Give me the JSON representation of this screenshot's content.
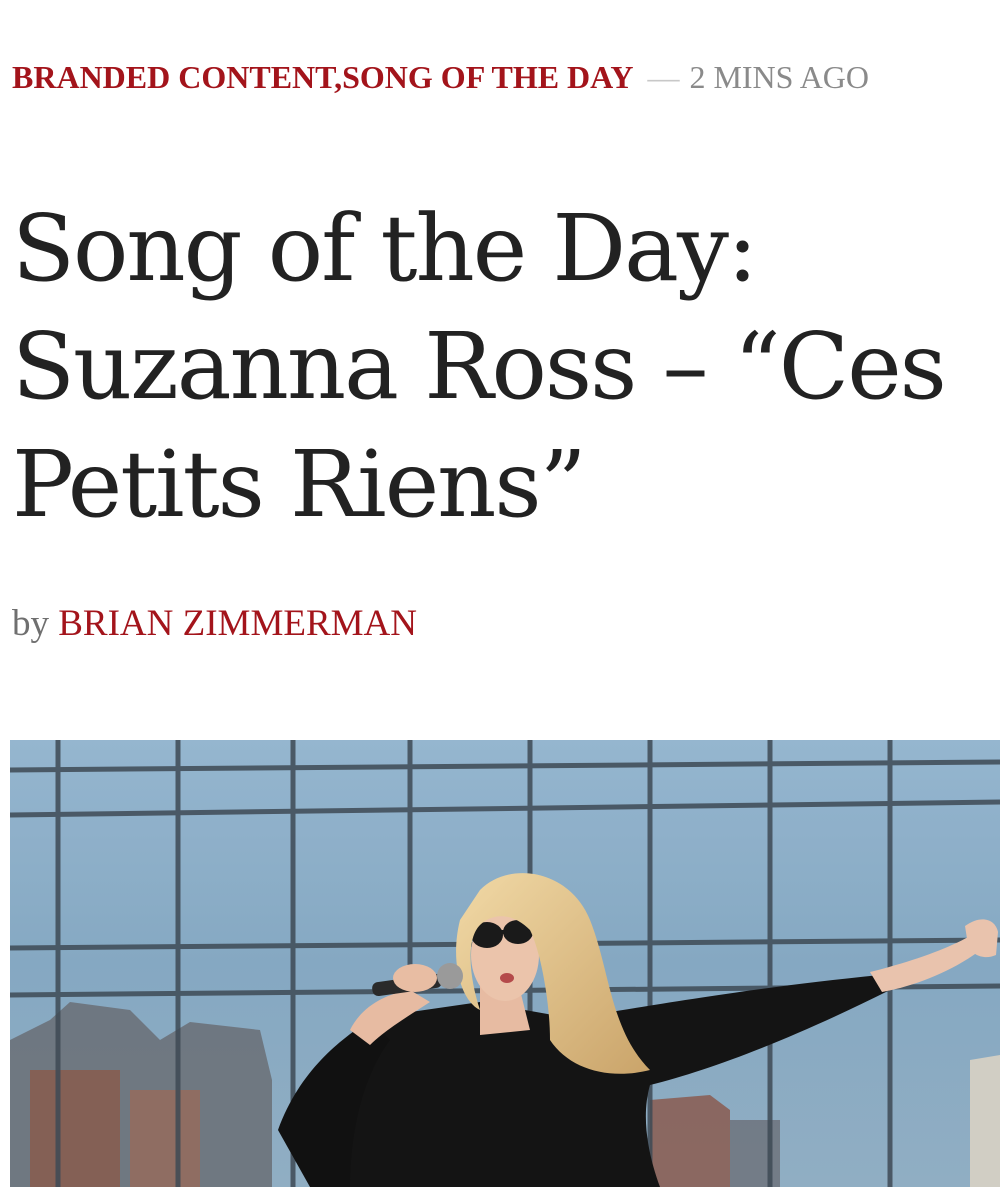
{
  "article": {
    "categories": [
      "BRANDED CONTENT",
      "SONG OF THE DAY"
    ],
    "separator": ",",
    "dash": "—",
    "time_ago": "2 MINS AGO",
    "title_lines": [
      "Song of the Day:",
      "Suzanna Ross – “Ces",
      "Petits Riens”"
    ],
    "by_label": "by",
    "author": "BRIAN ZIMMERMAN"
  },
  "colors": {
    "accent": "#a3141b",
    "title": "#222222",
    "muted": "#8a8a8a"
  },
  "hero_image": {
    "subject": "singer-with-microphone-photo"
  }
}
